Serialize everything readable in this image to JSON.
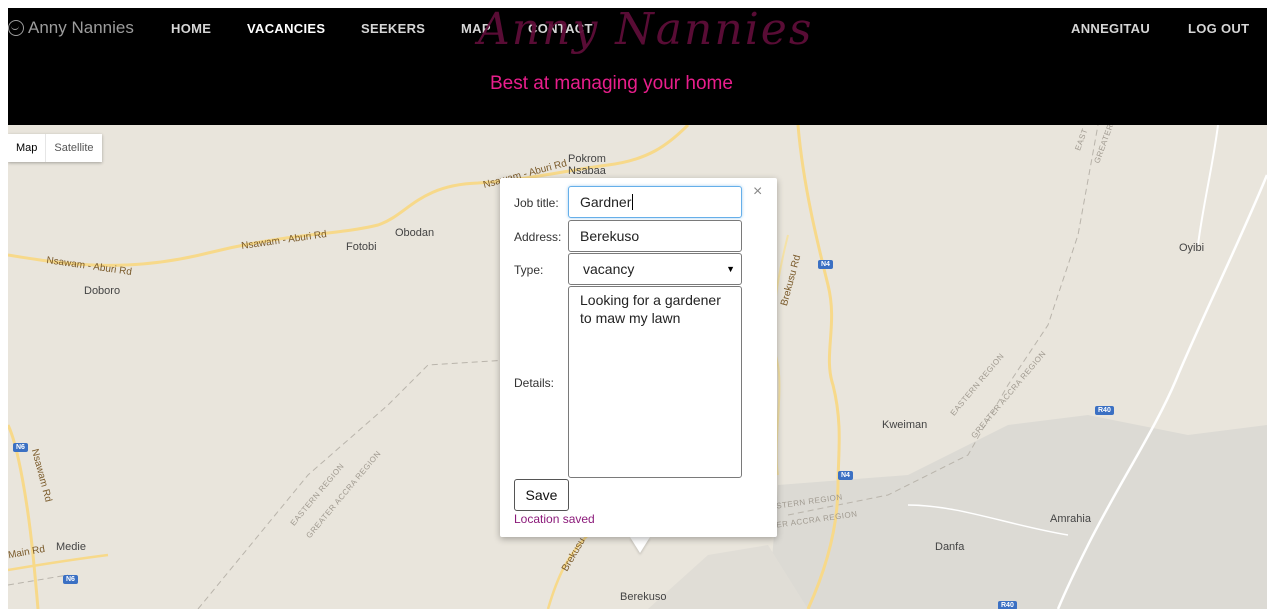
{
  "header": {
    "brand": "Anny Nannies",
    "nav": {
      "home": "HOME",
      "vacancies": "VACANCIES",
      "seekers": "SEEKERS",
      "map": "MAP",
      "contact": "CONTACT",
      "user": "ANNEGITAU",
      "logout": "LOG OUT"
    },
    "logo_script": "Anny Nannies",
    "tagline": "Best at managing your home"
  },
  "map": {
    "type_controls": {
      "map": "Map",
      "satellite": "Satellite"
    },
    "places": {
      "pokrom": "Pokrom",
      "nsabaa": "Nsabaa",
      "obodan": "Obodan",
      "fotobi": "Fotobi",
      "doboro": "Doboro",
      "oyibi": "Oyibi",
      "kweiman": "Kweiman",
      "amrahia": "Amrahia",
      "danfa": "Danfa",
      "medie": "Medie",
      "berekuso": "Berekuso"
    },
    "roads": {
      "nsawam_aburi_1": "Nsawam - Aburi Rd",
      "nsawam_aburi_2": "Nsawam - Aburi Rd",
      "nsawam_aburi_top": "Nsawam - Aburi Rd",
      "brekusu_rd": "Brekusu Rd",
      "nsawam_rd": "Nsawam Rd",
      "main_rd": "Main Rd",
      "brekusu_bottom": "Brekusu R"
    },
    "shields": {
      "n4a": "N4",
      "n4b": "N4",
      "n6a": "N6",
      "n6b": "N6",
      "r40a": "R40",
      "r40b": "R40"
    },
    "regions": {
      "eastern_1": "EASTERN REGION",
      "greater_accra_1": "GREATER ACCRA REGION",
      "eastern_2": "EASTERN REGION",
      "greater_accra_2": "GREATER ACCRA REGION",
      "eastern_3": "STERN REGION",
      "greater_accra_3": "ER ACCRA REGION",
      "eastern_top": "EAST",
      "greater_top": "GREATER"
    }
  },
  "info_window": {
    "job_title_label": "Job title:",
    "job_title_value": "Gardner",
    "address_label": "Address:",
    "address_value": "Berekuso",
    "type_label": "Type:",
    "type_value": "vacancy",
    "details_label": "Details:",
    "details_value": "Looking for a gardener to maw my lawn",
    "save_label": "Save",
    "status": "Location saved",
    "close_glyph": "×"
  },
  "colors": {
    "header_bg": "#000000",
    "tagline": "#e91e8c",
    "logo_script": "#5e0d38",
    "status": "#8b1a7a",
    "map_bg": "#e9e5dc",
    "shield": "#3b70c3"
  }
}
